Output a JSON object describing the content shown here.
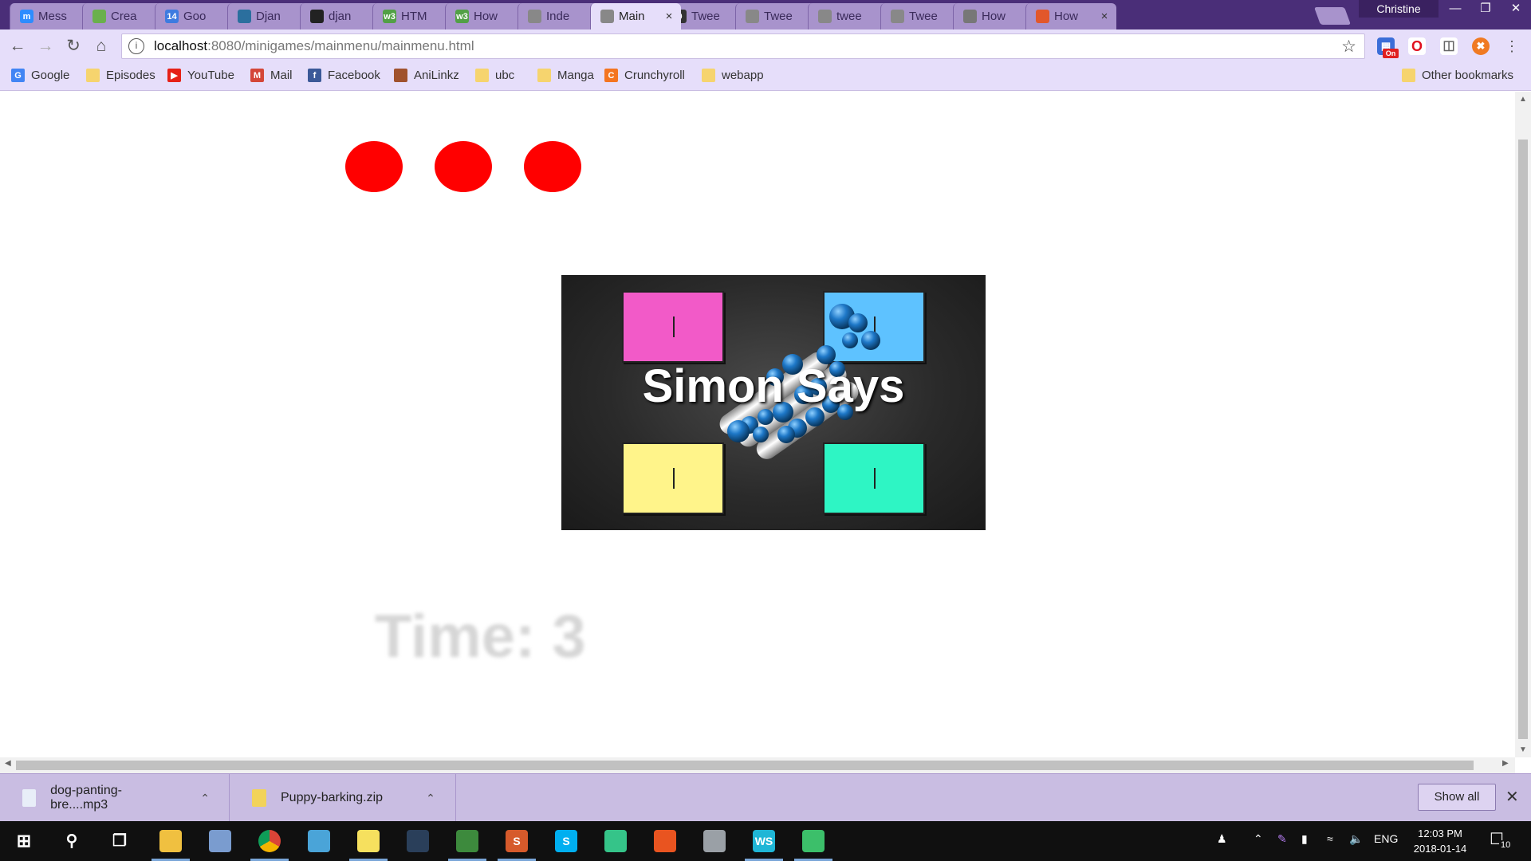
{
  "browser": {
    "profile": "Christine",
    "tabs": [
      {
        "label": "Mess",
        "color": "#2d8cff",
        "glyph": "m"
      },
      {
        "label": "Crea",
        "color": "#6ab04c",
        "glyph": ""
      },
      {
        "label": "Goo",
        "color": "#3d7be0",
        "glyph": "14"
      },
      {
        "label": "Djan",
        "color": "#2b6f9e",
        "glyph": ""
      },
      {
        "label": "djan",
        "color": "#222222",
        "glyph": ""
      },
      {
        "label": "HTM",
        "color": "#52a046",
        "glyph": "w3"
      },
      {
        "label": "How",
        "color": "#52a046",
        "glyph": "w3"
      },
      {
        "label": "Inde",
        "color": "#888888",
        "glyph": ""
      },
      {
        "label": "Main",
        "color": "#888888",
        "glyph": "",
        "active": true
      },
      {
        "label": "Twee",
        "color": "#333333",
        "glyph": "0"
      },
      {
        "label": "Twee",
        "color": "#888888",
        "glyph": ""
      },
      {
        "label": "twee",
        "color": "#888888",
        "glyph": ""
      },
      {
        "label": "Twee",
        "color": "#888888",
        "glyph": ""
      },
      {
        "label": "How",
        "color": "#777777",
        "glyph": ""
      },
      {
        "label": "How",
        "color": "#e2572b",
        "glyph": ""
      }
    ],
    "address": {
      "host": "localhost",
      "rest": ":8080/minigames/mainmenu/mainmenu.html"
    },
    "bookmarks": [
      {
        "label": "Google",
        "icon": "google-icon",
        "color": "#4285f4",
        "glyph": "G"
      },
      {
        "label": "Episodes",
        "icon": "folder-icon",
        "color": "#f6d46e",
        "glyph": ""
      },
      {
        "label": "YouTube",
        "icon": "youtube-icon",
        "color": "#e62117",
        "glyph": "▶"
      },
      {
        "label": "Mail",
        "icon": "mail-icon",
        "color": "#d44638",
        "glyph": "M"
      },
      {
        "label": "Facebook",
        "icon": "facebook-icon",
        "color": "#3b5998",
        "glyph": "f"
      },
      {
        "label": "AniLinkz",
        "icon": "anilinkz-icon",
        "color": "#a0522d",
        "glyph": ""
      },
      {
        "label": "ubc",
        "icon": "folder-icon",
        "color": "#f6d46e",
        "glyph": ""
      },
      {
        "label": "Manga",
        "icon": "folder-icon",
        "color": "#f6d46e",
        "glyph": ""
      },
      {
        "label": "Crunchyroll",
        "icon": "crunchyroll-icon",
        "color": "#f47521",
        "glyph": "C"
      },
      {
        "label": "webapp",
        "icon": "folder-icon",
        "color": "#f6d46e",
        "glyph": ""
      }
    ],
    "other_bookmarks": "Other bookmarks",
    "extension_badge": "On"
  },
  "page": {
    "lives": 3,
    "lives_color": "#ff0000",
    "splash_title": "Simon Says",
    "pads": [
      {
        "name": "pink",
        "color": "#f25ac8"
      },
      {
        "name": "blue",
        "color": "#5ec2ff"
      },
      {
        "name": "yellow",
        "color": "#fff48a"
      },
      {
        "name": "teal",
        "color": "#2ef5c4"
      }
    ],
    "timer_label": "Time: 3"
  },
  "downloads": {
    "items": [
      {
        "name": "dog-panting-bre....mp3",
        "icon": "audio-file-icon",
        "color": "#e8eef8"
      },
      {
        "name": "Puppy-barking.zip",
        "icon": "zip-file-icon",
        "color": "#f2d35a"
      }
    ],
    "show_all": "Show all"
  },
  "taskbar": {
    "apps": [
      {
        "name": "file-explorer",
        "color": "#f0c040",
        "glyph": ""
      },
      {
        "name": "photos",
        "color": "#7a9ccf",
        "glyph": ""
      },
      {
        "name": "chrome",
        "color": "#e0e0e0",
        "glyph": ""
      },
      {
        "name": "paint",
        "color": "#4aa4d8",
        "glyph": ""
      },
      {
        "name": "sticky-notes",
        "color": "#f6e05e",
        "glyph": ""
      },
      {
        "name": "steam",
        "color": "#2a3f5a",
        "glyph": ""
      },
      {
        "name": "android-studio",
        "color": "#3d8a3d",
        "glyph": ""
      },
      {
        "name": "sublime",
        "color": "#d65a2b",
        "glyph": "S"
      },
      {
        "name": "skype",
        "color": "#00aff0",
        "glyph": "S"
      },
      {
        "name": "atom",
        "color": "#35c489",
        "glyph": ""
      },
      {
        "name": "ubuntu",
        "color": "#e95420",
        "glyph": ""
      },
      {
        "name": "database",
        "color": "#9aa0a6",
        "glyph": ""
      },
      {
        "name": "webstorm",
        "color": "#1fb6d6",
        "glyph": "WS"
      },
      {
        "name": "gitkraken",
        "color": "#3cbf6a",
        "glyph": ""
      }
    ],
    "language": "ENG",
    "time": "12:03 PM",
    "date": "2018-01-14",
    "notification_count": "10"
  }
}
